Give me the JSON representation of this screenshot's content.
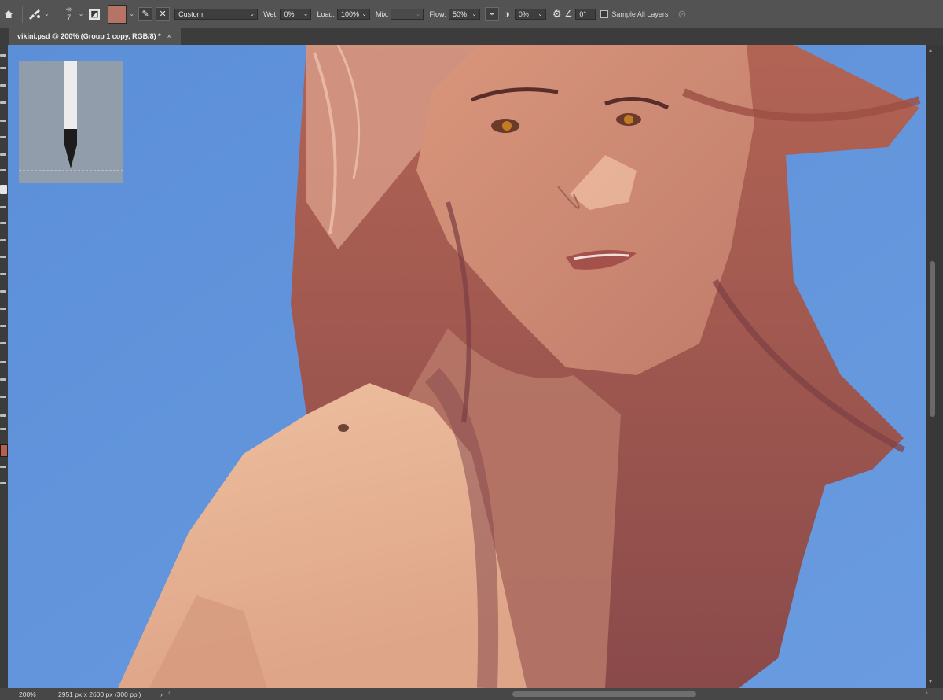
{
  "options_bar": {
    "home_icon": "home-icon",
    "brush_tool_icon": "mixer-brush-icon",
    "brush_size": "7",
    "current_color": "#b77464",
    "preset": "Custom",
    "wet_label": "Wet:",
    "wet_value": "0%",
    "load_label": "Load:",
    "load_value": "100%",
    "mix_label": "Mix:",
    "mix_value": "",
    "flow_label": "Flow:",
    "flow_value": "50%",
    "smoothing_value": "0%",
    "angle_value": "0°",
    "sample_all_layers_label": "Sample All Layers",
    "sample_all_layers_checked": false
  },
  "document_tab": {
    "title": "vikini.psd @ 200% (Group 1 copy, RGB/8) *",
    "close_glyph": "×"
  },
  "toolbar": {
    "foreground_color": "#b5614d"
  },
  "status_bar": {
    "zoom": "200%",
    "doc_info": "2951 px x 2600 px (300 ppi)",
    "expand_glyph": "›",
    "scroll_left_glyph": "‹",
    "scroll_right_glyph": "›"
  },
  "colors": {
    "sky_blue": "#5b8ed6",
    "hair_red": "#9c4f45",
    "skin": "#e3ab8e",
    "ui_panel": "#535353"
  }
}
